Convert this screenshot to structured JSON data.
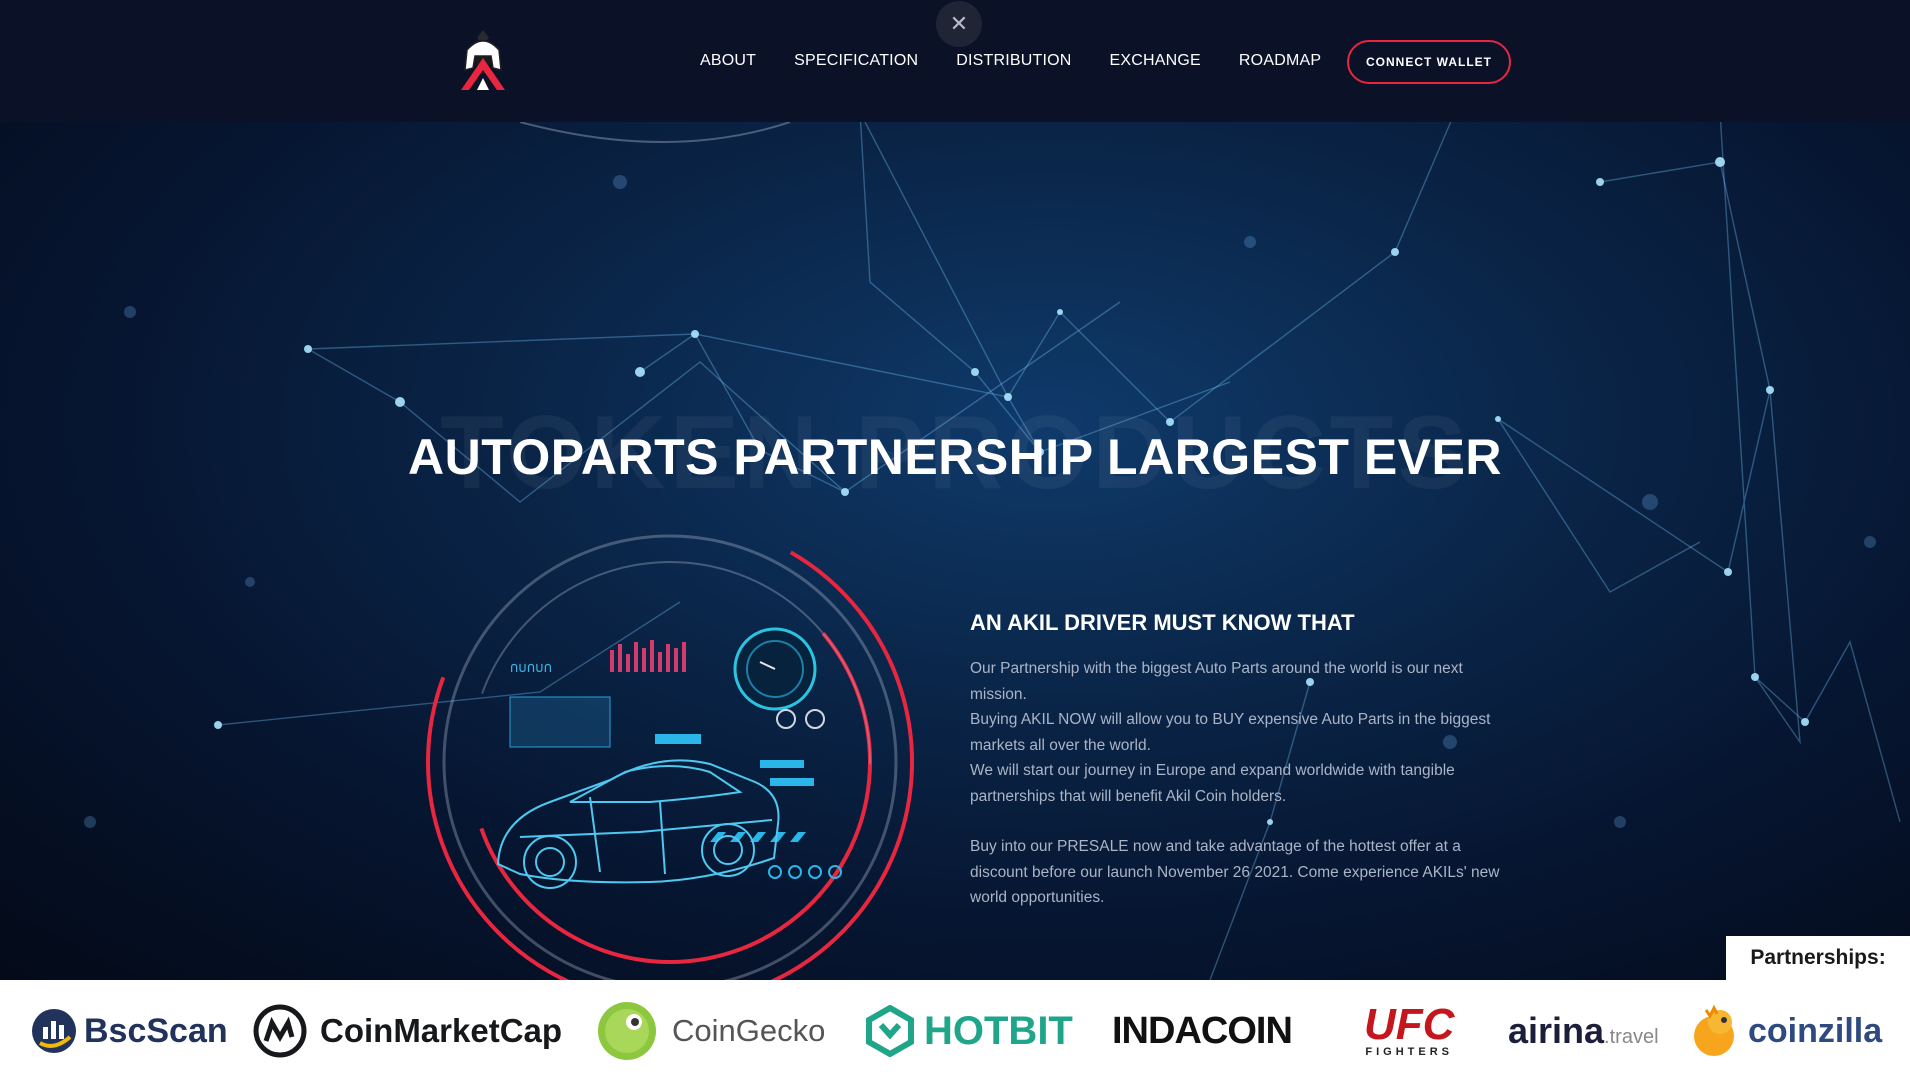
{
  "header": {
    "logo_alt": "Akil logo",
    "nav": [
      "ABOUT",
      "SPECIFICATION",
      "DISTRIBUTION",
      "EXCHANGE",
      "ROADMAP"
    ],
    "close_symbol": "✕",
    "connect_label": "CONNECT WALLET"
  },
  "hero": {
    "ghost_text": "TOKEN PRODUCTS",
    "title": "AUTOPARTS PARTNERSHIP LARGEST EVER",
    "section_heading": "AN AKIL DRIVER MUST KNOW THAT",
    "paragraphs": [
      "Our Partnership with the biggest Auto Parts around the world is our next mission.",
      "Buying AKIL NOW will allow you to BUY expensive Auto Parts in the biggest markets all over the world.",
      "We will start our journey in Europe and expand worldwide with tangible partnerships that will benefit Akil Coin holders.",
      "Buy into our PRESALE now and take advantage of the hottest offer at a discount before our launch November 26 2021. Come experience AKILs' new world opportunities."
    ]
  },
  "partners": {
    "label": "Partnerships:",
    "items": [
      {
        "name": "BscScan",
        "icon": "bscscan-icon",
        "color": "#21325b"
      },
      {
        "name": "CoinMarketCap",
        "icon": "coinmarketcap-icon",
        "color": "#17181b"
      },
      {
        "name": "CoinGecko",
        "icon": "coingecko-icon",
        "color": "#555555"
      },
      {
        "name": "HOTBIT",
        "icon": "hotbit-icon",
        "color": "#1fa58a"
      },
      {
        "name": "INDACOIN",
        "icon": "indacoin-icon",
        "color": "#111111"
      },
      {
        "name": "UFC",
        "sub": "FIGHTERS",
        "icon": "ufc-icon",
        "color": "#c4161c"
      },
      {
        "name": "airina",
        "sub": ".travel",
        "icon": "airina-icon",
        "color": "#1b1f3b"
      },
      {
        "name": "coinzilla",
        "icon": "coinzilla-icon",
        "color": "#2f4a80"
      }
    ]
  },
  "colors": {
    "accent": "#e8263f",
    "header_bg": "#0b1228",
    "text_muted": "#aab4c6"
  }
}
